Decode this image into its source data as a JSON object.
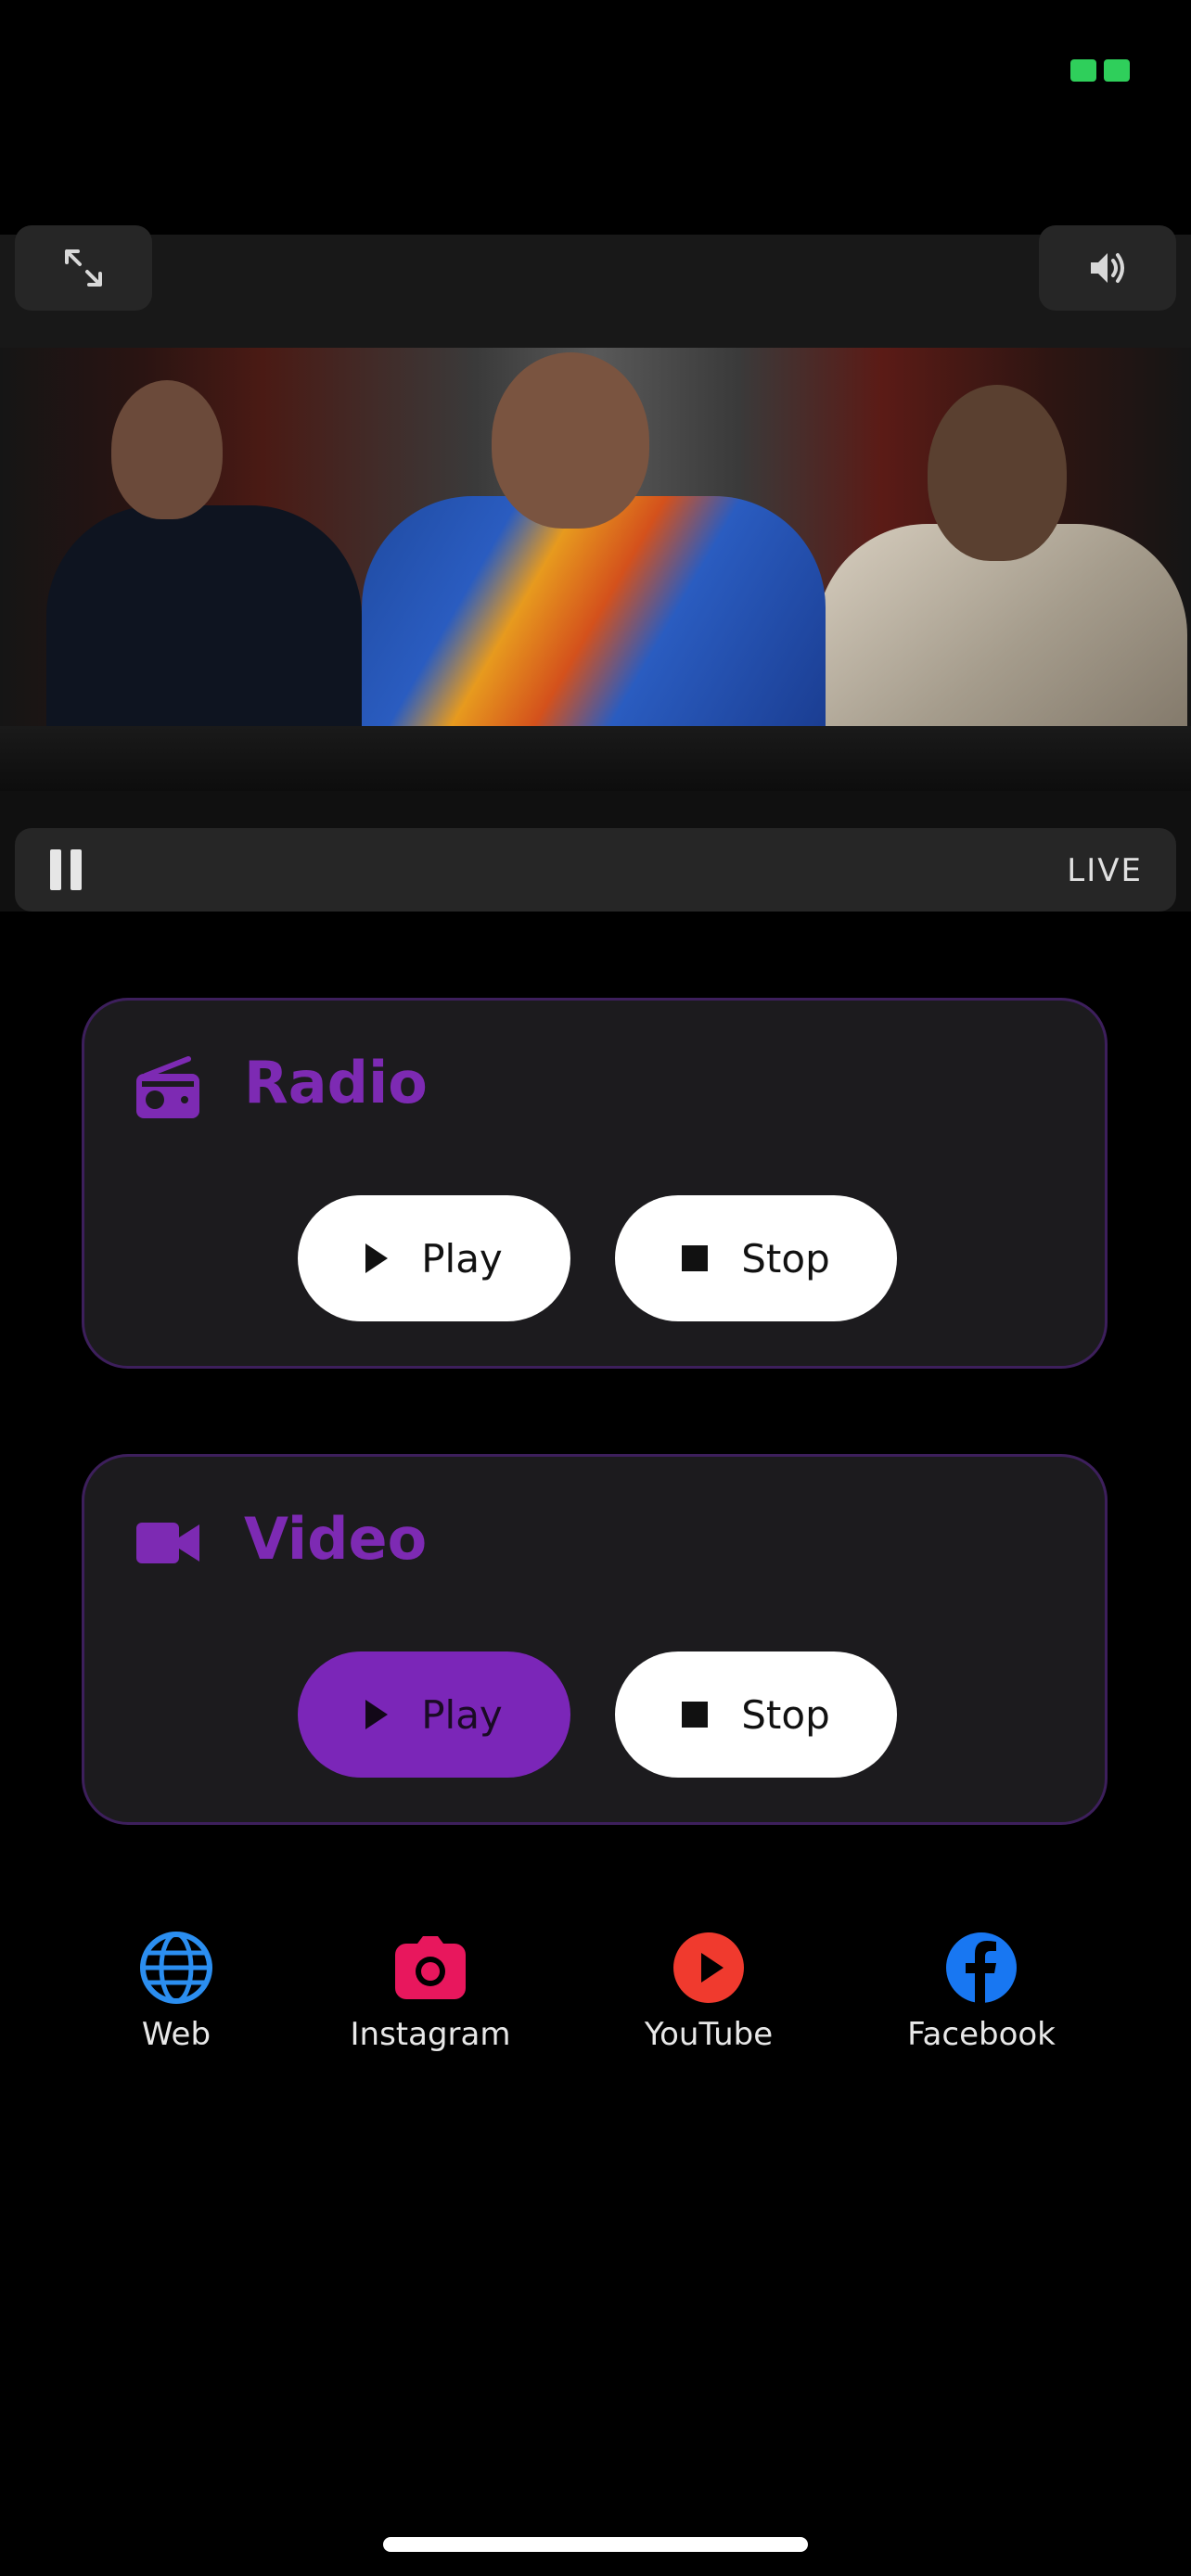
{
  "player": {
    "live_label": "LIVE"
  },
  "radio": {
    "title": "Radio",
    "play_label": "Play",
    "stop_label": "Stop"
  },
  "video": {
    "title": "Video",
    "play_label": "Play",
    "stop_label": "Stop"
  },
  "social": [
    {
      "label": "Web",
      "icon": "globe-icon",
      "color": "#2b8ef0"
    },
    {
      "label": "Instagram",
      "icon": "camera-icon",
      "color": "#e8175d"
    },
    {
      "label": "YouTube",
      "icon": "youtube-icon",
      "color": "#f03a2e"
    },
    {
      "label": "Facebook",
      "icon": "facebook-icon",
      "color": "#1877f2"
    }
  ],
  "colors": {
    "accent": "#7b26b8",
    "card_background": "#1c1b1e",
    "status_green": "#2fcf5b"
  }
}
